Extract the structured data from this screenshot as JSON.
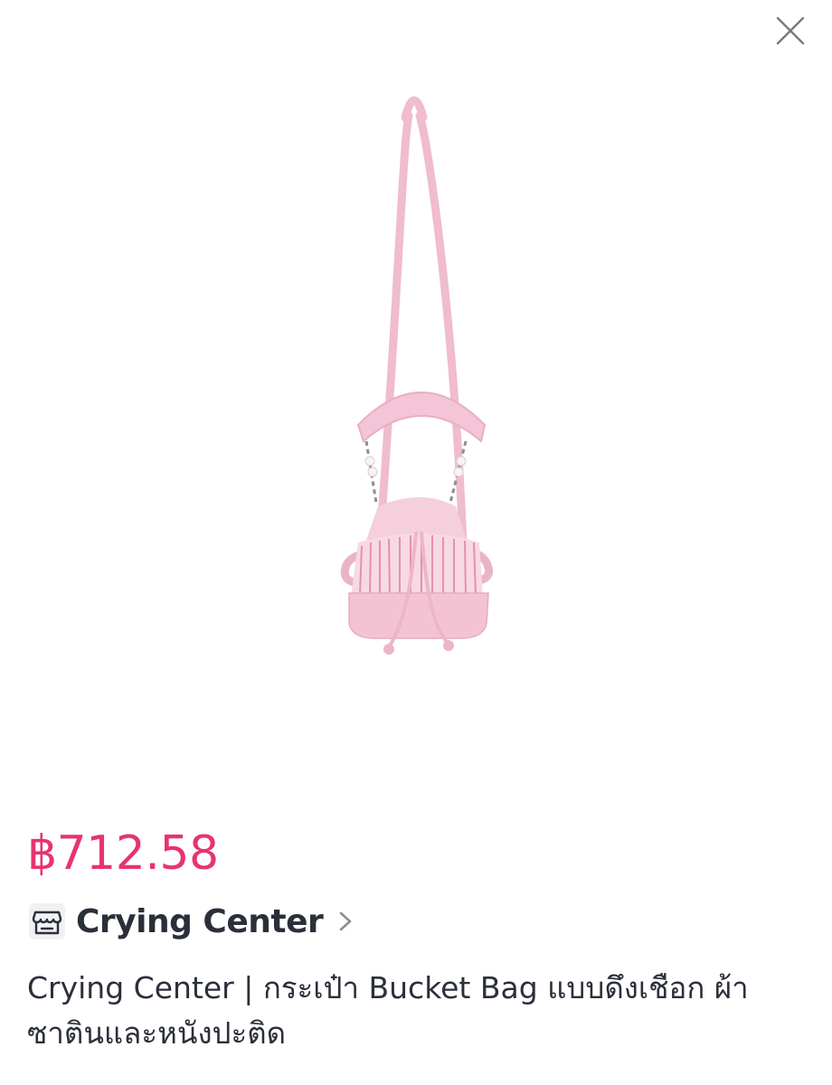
{
  "close": {
    "icon": "close-icon"
  },
  "product": {
    "image": {
      "icon": "pink-bucket-bag-photo"
    },
    "price": "฿712.58",
    "shop": {
      "name": "Crying Center",
      "icon": "store-icon",
      "chevron": "chevron-right-icon"
    },
    "title": "Crying Center | กระเป๋า Bucket Bag แบบดึงเชือก ผ้าซาตินและหนังปะติด"
  },
  "colors": {
    "price": "#e8336f",
    "text": "#2b2f3a",
    "bag_pink": "#f2c6d6"
  }
}
